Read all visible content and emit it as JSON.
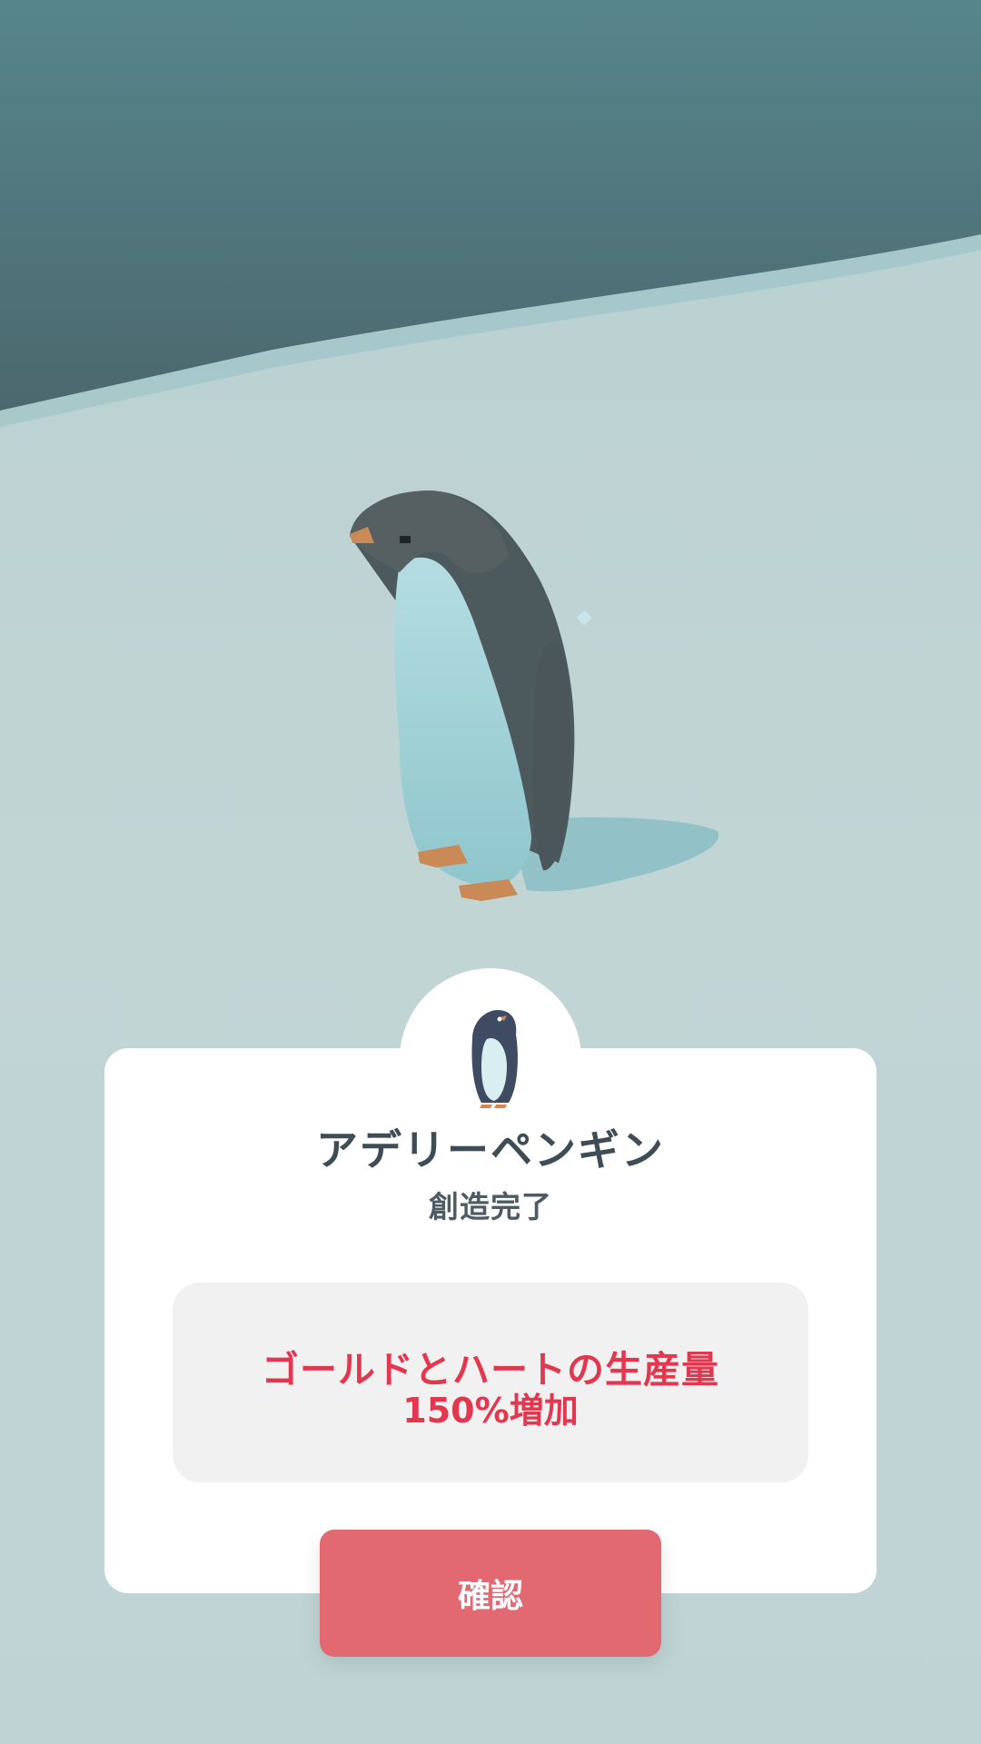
{
  "creature": {
    "name": "アデリーペンギン",
    "status": "創造完了",
    "icon": "penguin-icon"
  },
  "bonus": {
    "line1": "ゴールドとハートの生産量",
    "line2": "150%増加"
  },
  "actions": {
    "confirm_label": "確認"
  },
  "colors": {
    "accent_red": "#e1384f",
    "button_red": "#e26871",
    "sky_teal": "#4e6f74",
    "ice": "#bcd3d5"
  }
}
